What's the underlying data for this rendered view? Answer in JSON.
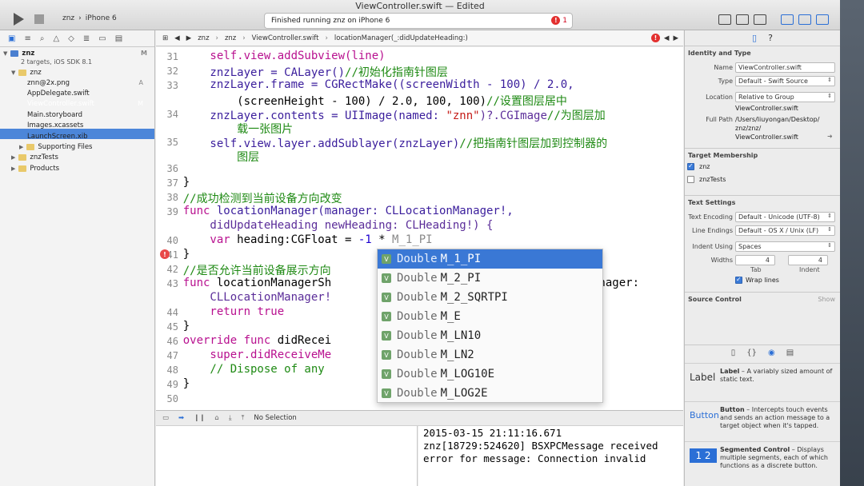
{
  "window": {
    "title": "ViewController.swift — Edited"
  },
  "toolbar": {
    "project": "znz",
    "device": "iPhone 6",
    "activity": "Finished running znz on iPhone 6",
    "error_count": "1"
  },
  "navigator": {
    "project_name": "znz",
    "project_subtitle": "2 targets, iOS SDK 8.1",
    "project_badge": "M",
    "items": [
      {
        "label": "znz",
        "badge": ""
      },
      {
        "label": "znn@2x.png",
        "badge": "A"
      },
      {
        "label": "AppDelegate.swift",
        "badge": ""
      },
      {
        "label": "ViewController.swift",
        "badge": "M"
      },
      {
        "label": "Main.storyboard",
        "badge": ""
      },
      {
        "label": "Images.xcassets",
        "badge": ""
      },
      {
        "label": "LaunchScreen.xib",
        "badge": ""
      },
      {
        "label": "Supporting Files",
        "badge": ""
      },
      {
        "label": "znzTests",
        "badge": ""
      },
      {
        "label": "Products",
        "badge": ""
      }
    ]
  },
  "jumpbar": {
    "crumbs": [
      "znz",
      "znz",
      "ViewController.swift",
      "locationManager(_:didUpdateHeading:)"
    ]
  },
  "code": {
    "line_numbers": [
      "31",
      "32",
      "33",
      "",
      "34",
      "",
      "35",
      "",
      "36",
      "37",
      "38",
      "39",
      "",
      "40",
      "41",
      "42",
      "43",
      "",
      "44",
      "45",
      "46",
      "47",
      "48",
      "49",
      "50"
    ],
    "lines": {
      "l31": "        self.view.addSubview(line)",
      "l32a": "        znzLayer = CALayer()",
      "l32b": "//初始化指南针图层",
      "l33a": "        znzLayer.frame = CGRectMake((screenWidth - 100) / 2.0,",
      "l33b": "            (screenHeight - 100) / 2.0, 100, 100)",
      "l33c": "//设置图层居中",
      "l34a": "        znzLayer.contents = UIImage(named: ",
      "l34s": "\"znn\"",
      "l34b": ")?.CGImage",
      "l34c": "//为图层加",
      "l34d": "            载一张图片",
      "l35a": "        self.view.layer.addSublayer(znzLayer)",
      "l35c": "//把指南针图层加到控制器的",
      "l35d": "            图层",
      "l37": "    }",
      "l38": "    //成功检测到当前设备方向改变",
      "l39a": "    func ",
      "l39b": "locationManager(manager: CLLocationManager!,",
      "l39c": "        didUpdateHeading newHeading: CLHeading!) {",
      "l40a": "        var ",
      "l40b": "heading:CGFloat = ",
      "l40c": "-1",
      "l40d": " * ",
      "l40e": "M_1_PI",
      "l41": "    }",
      "l42": "    //是否允许当前设备展示方向",
      "l43a": "    func ",
      "l43b": "locationManagerSh",
      "l43c": "anager:",
      "l43d": "        CLLocationManager!",
      "l44a": "        return ",
      "l44b": "true",
      "l45": "    }",
      "l46a": "    override func ",
      "l46b": "didRecei",
      "l47": "        super.didReceiveMe",
      "l48": "        // Dispose of any",
      "l49": "    }"
    }
  },
  "completion": {
    "items": [
      {
        "type": "Double",
        "name": "M_1_PI"
      },
      {
        "type": "Double",
        "name": "M_2_PI"
      },
      {
        "type": "Double",
        "name": "M_2_SQRTPI"
      },
      {
        "type": "Double",
        "name": "M_E"
      },
      {
        "type": "Double",
        "name": "M_LN10"
      },
      {
        "type": "Double",
        "name": "M_LN2"
      },
      {
        "type": "Double",
        "name": "M_LOG10E"
      },
      {
        "type": "Double",
        "name": "M_LOG2E"
      }
    ]
  },
  "debug": {
    "selection": "No Selection",
    "console": [
      "2015-03-15 21:11:16.671",
      "znz[18729:524620] BSXPCMessage received",
      "error for message: Connection invalid"
    ]
  },
  "inspector": {
    "identity_title": "Identity and Type",
    "name_label": "Name",
    "name_value": "ViewController.swift",
    "type_label": "Type",
    "type_value": "Default - Swift Source",
    "location_label": "Location",
    "location_value": "Relative to Group",
    "location_file": "ViewController.swift",
    "fullpath_label": "Full Path",
    "fullpath_value": [
      "/Users/liuyongan/Desktop/",
      "znz/znz/",
      "ViewController.swift"
    ],
    "target_title": "Target Membership",
    "targets": [
      {
        "label": "znz",
        "checked": true
      },
      {
        "label": "znzTests",
        "checked": false
      }
    ],
    "text_title": "Text Settings",
    "encoding_label": "Text Encoding",
    "encoding_value": "Default - Unicode (UTF-8)",
    "endings_label": "Line Endings",
    "endings_value": "Default - OS X / Unix (LF)",
    "indent_label": "Indent Using",
    "indent_value": "Spaces",
    "widths_label": "Widths",
    "tab_value": "4",
    "indent_width_value": "4",
    "tab_caption": "Tab",
    "indent_caption": "Indent",
    "wrap_label": "Wrap lines",
    "source_control_title": "Source Control",
    "source_control_action": "Show",
    "library": [
      {
        "icon": "Label",
        "title": "Label",
        "desc": " – A variably sized amount of static text."
      },
      {
        "icon": "Button",
        "title": "Button",
        "desc": " – Intercepts touch events and sends an action message to a target object when it's tapped."
      },
      {
        "icon": "1 2",
        "title": "Segmented Control",
        "desc": " – Displays multiple segments, each of which functions as a discrete button."
      }
    ]
  },
  "colors": {
    "selection": "#3a78d5",
    "keyword": "#b8108f",
    "comment": "#1f8a14",
    "error": "#e3302f"
  }
}
